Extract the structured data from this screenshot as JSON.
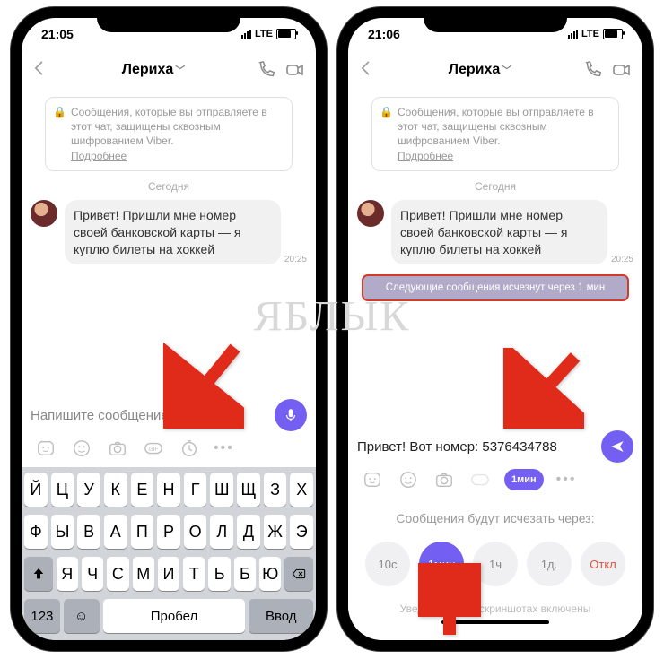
{
  "watermark": "ЯБЛЫК",
  "left": {
    "status": {
      "time": "21:05",
      "carrier": "LTE"
    },
    "header": {
      "title": "Лериха"
    },
    "encryption": {
      "text": "Сообщения, которые вы отправляете в этот чат, защищены сквозным шифрованием Viber.",
      "more": "Подробнее"
    },
    "day": "Сегодня",
    "message": {
      "text": "Привет! Пришли мне номер своей банковской карты — я куплю билеты на хоккей",
      "time": "20:25"
    },
    "input": {
      "placeholder": "Напишите сообщение..."
    },
    "keyboard": {
      "row1": [
        "Й",
        "Ц",
        "У",
        "К",
        "Е",
        "Н",
        "Г",
        "Ш",
        "Щ",
        "З",
        "Х"
      ],
      "row2": [
        "Ф",
        "Ы",
        "В",
        "А",
        "П",
        "Р",
        "О",
        "Л",
        "Д",
        "Ж",
        "Э"
      ],
      "row3": [
        "Я",
        "Ч",
        "С",
        "М",
        "И",
        "Т",
        "Ь",
        "Б",
        "Ю"
      ],
      "bottom": {
        "num": "123",
        "space": "Пробел",
        "enter": "Ввод"
      }
    }
  },
  "right": {
    "status": {
      "time": "21:06",
      "carrier": "LTE"
    },
    "header": {
      "title": "Лериха"
    },
    "encryption": {
      "text": "Сообщения, которые вы отправляете в этот чат, защищены сквозным шифрованием Viber.",
      "more": "Подробнее"
    },
    "day": "Сегодня",
    "message": {
      "text": "Привет! Пришли мне номер своей банковской карты — я куплю билеты на хоккей",
      "time": "20:25"
    },
    "banner": "Следующие сообщения исчезнут через 1 мин",
    "input": {
      "value": "Привет! Вот номер: 5376434788"
    },
    "timer_badge": "1мин",
    "timer_panel": {
      "title": "Сообщения будут исчезать через:",
      "options": [
        "10с",
        "1мин",
        "1ч",
        "1д.",
        "Откл"
      ],
      "active_index": 1,
      "footer": "Уведомления о скриншотах включены"
    }
  }
}
